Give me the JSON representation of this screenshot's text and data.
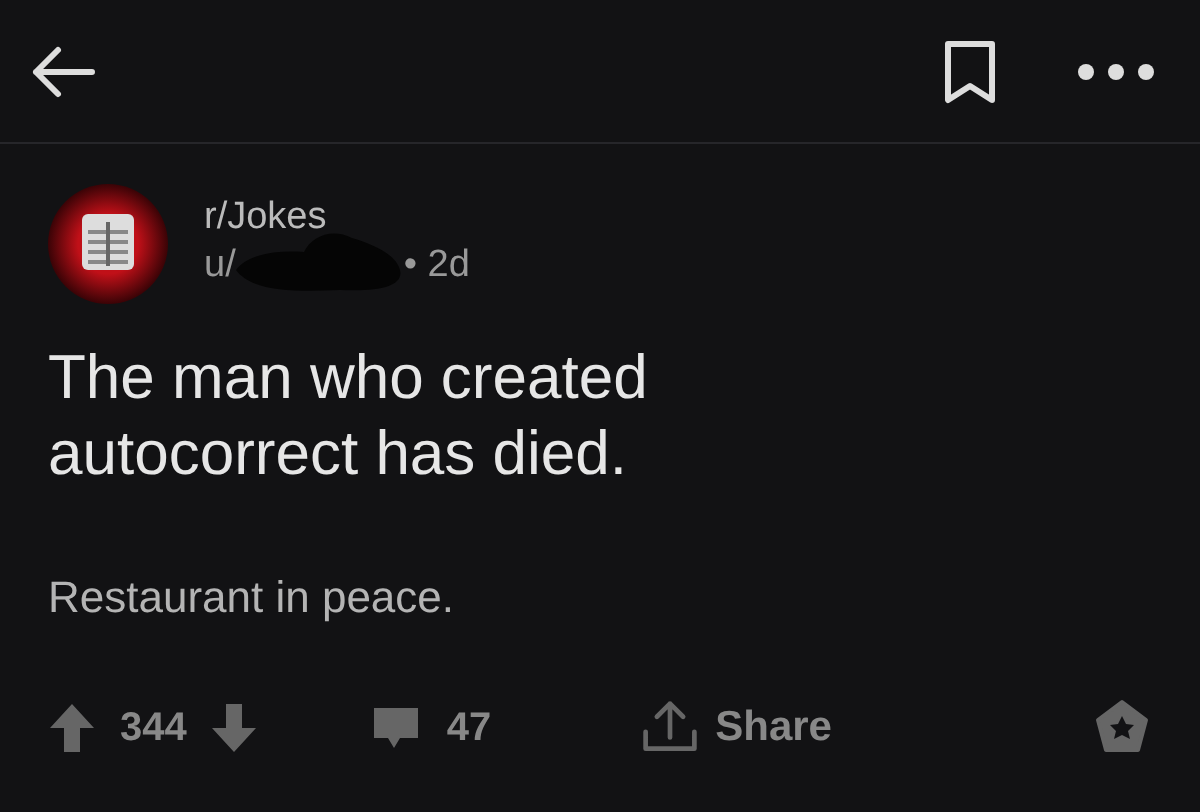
{
  "post": {
    "subreddit": "r/Jokes",
    "user": "u/",
    "age": "• 2d",
    "title": "The man who created autocorrect has died.",
    "body": "Restaurant in peace."
  },
  "actions": {
    "upvotes": "344",
    "comments": "47",
    "share": "Share"
  }
}
